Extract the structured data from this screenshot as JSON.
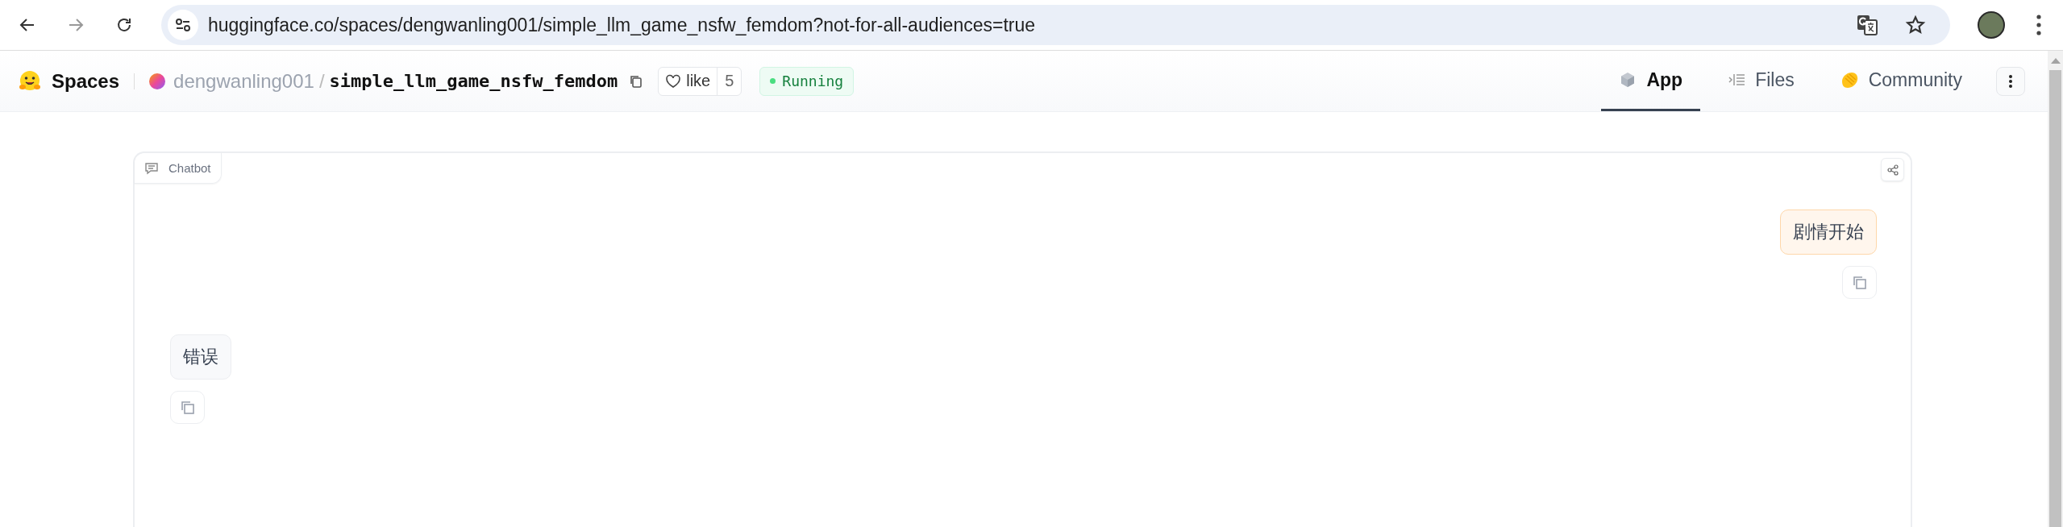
{
  "browser": {
    "url": "huggingface.co/spaces/dengwanling001/simple_llm_game_nsfw_femdom?not-for-all-audiences=true"
  },
  "header": {
    "brand": "Spaces",
    "owner": "dengwanling001",
    "separator": "/",
    "repo": "simple_llm_game_nsfw_femdom",
    "like_label": "like",
    "like_count": "5",
    "status": "Running"
  },
  "tabs": [
    {
      "label": "App",
      "kind": "app",
      "selected": true
    },
    {
      "label": "Files",
      "kind": "files",
      "selected": false
    },
    {
      "label": "Community",
      "kind": "community",
      "selected": false
    }
  ],
  "chatbot": {
    "label": "Chatbot",
    "messages": [
      {
        "kind": "user",
        "text": "剧情开始"
      },
      {
        "kind": "bot",
        "text": "错误"
      }
    ]
  }
}
